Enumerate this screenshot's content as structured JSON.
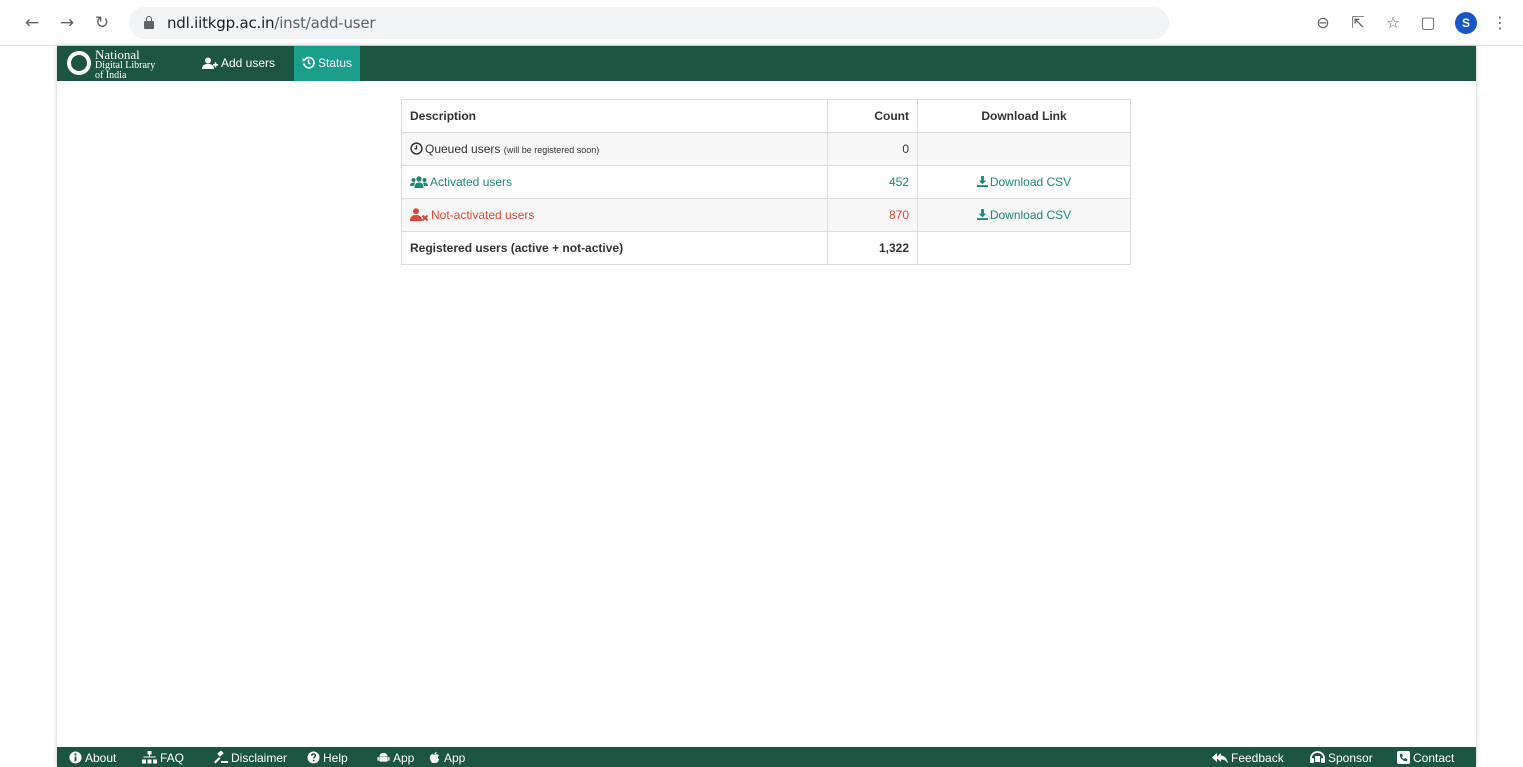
{
  "browser": {
    "url_host": "ndl.iitkgp.ac.in",
    "url_path": "/inst/add-user",
    "profile_initial": "S"
  },
  "navbar": {
    "logo_line1": "National",
    "logo_line2": "Digital Library",
    "logo_line3": "of India",
    "items": [
      {
        "label": "Add users",
        "icon": "add-user-icon",
        "active": false
      },
      {
        "label": "Status",
        "icon": "history-icon",
        "active": true
      }
    ]
  },
  "table": {
    "headers": {
      "description": "Description",
      "count": "Count",
      "download": "Download Link"
    },
    "rows": [
      {
        "label": "Queued users",
        "note": "(will be registered soon)",
        "count": "0",
        "download": "",
        "icon": "clock-icon"
      },
      {
        "label": "Activated users",
        "count": "452",
        "download": "Download CSV",
        "icon": "users-icon"
      },
      {
        "label": "Not-activated users",
        "count": "870",
        "download": "Download CSV",
        "icon": "user-remove-icon"
      },
      {
        "label": "Registered users (active + not-active)",
        "count": "1,322",
        "download": ""
      }
    ]
  },
  "footer": {
    "left": [
      {
        "label": "About",
        "icon": "info-icon"
      },
      {
        "label": "FAQ",
        "icon": "sitemap-icon"
      },
      {
        "label": "Disclaimer",
        "icon": "gavel-icon"
      },
      {
        "label": "Help",
        "icon": "question-icon"
      },
      {
        "label": "App",
        "icon": "android-icon"
      },
      {
        "label": "App",
        "icon": "apple-icon"
      }
    ],
    "right": [
      {
        "label": "Feedback",
        "icon": "reply-all-icon"
      },
      {
        "label": "Sponsor",
        "icon": "sponsor-icon"
      },
      {
        "label": "Contact",
        "icon": "contact-icon"
      }
    ]
  },
  "colors": {
    "brand_green": "#1c5542",
    "active_tab": "#1b9e8c",
    "activated_text": "#1b8a74",
    "not_activated_text": "#e0473a"
  }
}
